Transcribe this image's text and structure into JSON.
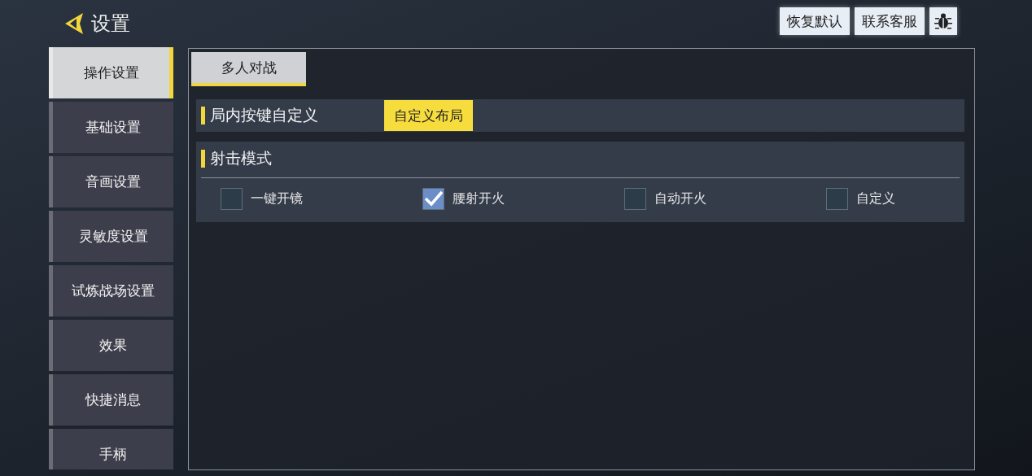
{
  "header": {
    "title": "设置"
  },
  "top_buttons": [
    {
      "kind": "text",
      "label": "恢复默认"
    },
    {
      "kind": "text",
      "label": "联系客服"
    },
    {
      "kind": "bug"
    }
  ],
  "sidebar": {
    "items": [
      {
        "label": "操作设置",
        "selected": true
      },
      {
        "label": "基础设置",
        "selected": false
      },
      {
        "label": "音画设置",
        "selected": false
      },
      {
        "label": "灵敏度设置",
        "selected": false
      },
      {
        "label": "试炼战场设置",
        "selected": false
      },
      {
        "label": "效果",
        "selected": false
      },
      {
        "label": "快捷消息",
        "selected": false
      },
      {
        "label": "手柄",
        "selected": false
      }
    ]
  },
  "tabs": [
    {
      "label": "多人对战",
      "selected": true
    }
  ],
  "sections": [
    {
      "kind": "button",
      "title": "局内按键自定义",
      "button": "自定义布局"
    },
    {
      "kind": "options",
      "title": "射击模式",
      "options": [
        {
          "label": "一键开镜",
          "checked": false
        },
        {
          "label": "腰射开火",
          "checked": true
        },
        {
          "label": "自动开火",
          "checked": false
        },
        {
          "label": "自定义",
          "checked": false
        }
      ]
    }
  ]
}
